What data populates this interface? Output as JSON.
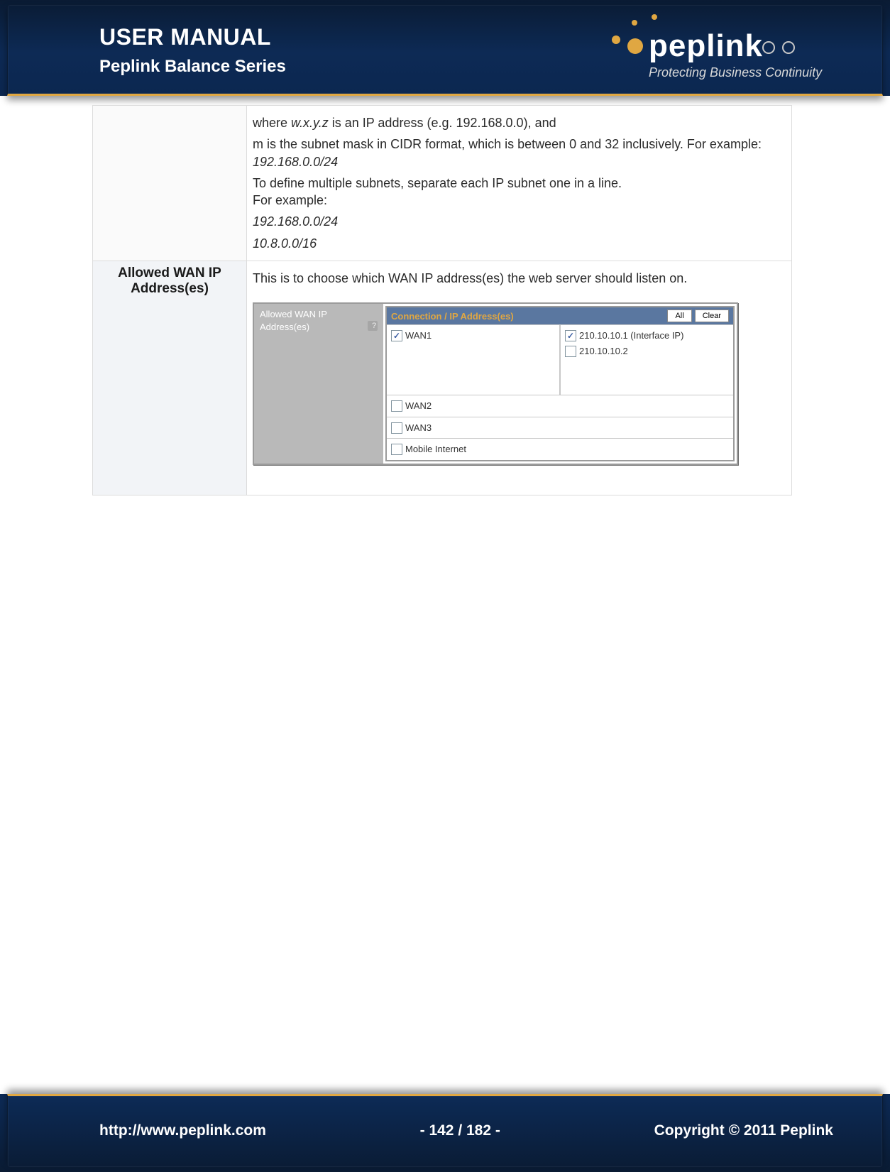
{
  "header": {
    "title": "USER MANUAL",
    "subtitle": "Peplink Balance Series",
    "brand_word": "peplink",
    "brand_tag": "Protecting Business Continuity"
  },
  "footer": {
    "url": "http://www.peplink.com",
    "page": "- 142 / 182 -",
    "copyright": "Copyright © 2011 Peplink"
  },
  "row1": {
    "p1_a": "where ",
    "p1_i": "w.x.y.z",
    "p1_b": " is an IP address (e.g. 192.168.0.0), and",
    "p2_a": "m is the subnet mask in CIDR format, which is between 0 and 32 inclusively. For example: ",
    "p2_i": "192.168.0.0/24",
    "p3": "To define multiple subnets, separate each IP subnet one in a line.",
    "p4": "For example:",
    "ex1": "192.168.0.0/24",
    "ex2": "10.8.0.0/16"
  },
  "row2": {
    "label": "Allowed WAN IP Address(es)",
    "desc": "This is to choose which WAN IP address(es) the web server should listen on.",
    "panel": {
      "side_label": "Allowed WAN IP Address(es)",
      "side_help": "?",
      "header": "Connection / IP Address(es)",
      "btn_all": "All",
      "btn_clear": "Clear",
      "wan1": {
        "name": "WAN1",
        "checked": true,
        "ips": [
          {
            "label": "210.10.10.1 (Interface IP)",
            "checked": true
          },
          {
            "label": "210.10.10.2",
            "checked": false
          }
        ]
      },
      "wan2": {
        "name": "WAN2",
        "checked": false
      },
      "wan3": {
        "name": "WAN3",
        "checked": false
      },
      "mobile": {
        "name": "Mobile Internet",
        "checked": false
      }
    }
  }
}
